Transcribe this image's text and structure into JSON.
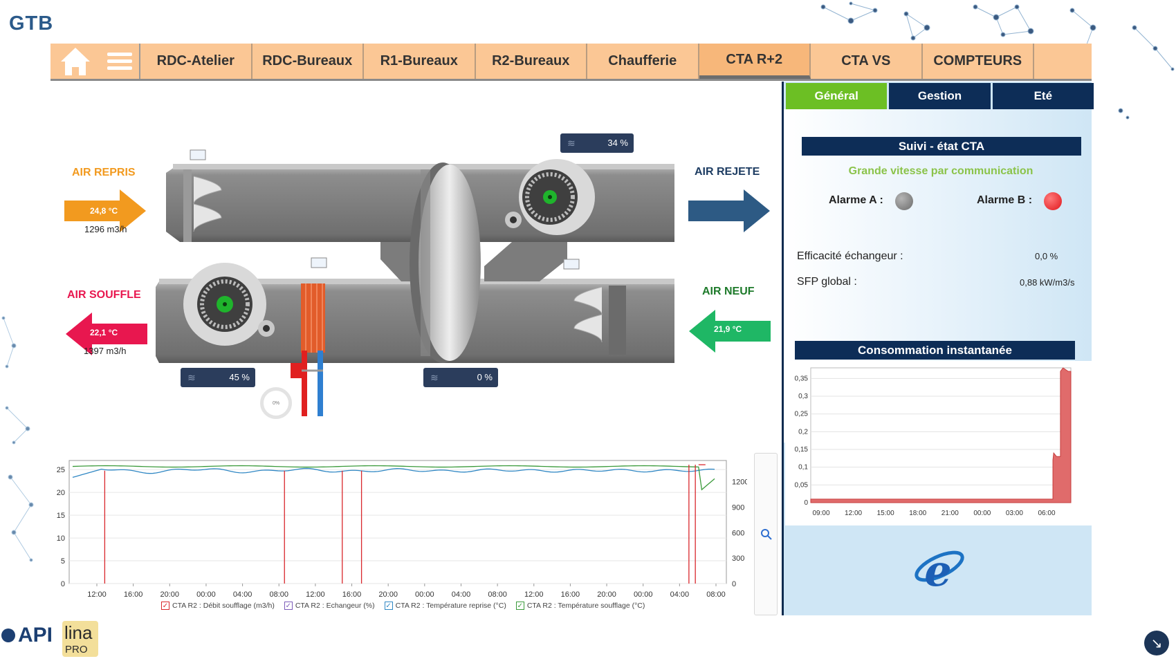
{
  "app": {
    "title": "GTB"
  },
  "nav": {
    "tabs": [
      "RDC-Atelier",
      "RDC-Bureaux",
      "R1-Bureaux",
      "R2-Bureaux",
      "Chaufferie",
      "CTA R+2",
      "CTA VS",
      "COMPTEURS"
    ],
    "active_tab": "CTA R+2",
    "home_icon": "home-icon",
    "menu_icon": "hamburger-menu-icon"
  },
  "right_panel": {
    "tabs": [
      "Général",
      "Gestion",
      "Eté"
    ],
    "active_tab": "Général",
    "suivi_title": "Suivi - état CTA",
    "status_text": "Grande vitesse par communication",
    "alarm_a_label": "Alarme A :",
    "alarm_b_label": "Alarme B :",
    "alarm_a_color": "#7a7a7a",
    "alarm_b_color": "#e0151b",
    "efficacite_label": "Efficacité échangeur  :",
    "efficacite_value": "0,0 %",
    "sfp_label": "SFP global  :",
    "sfp_value": "0,88 kW/m3/s",
    "conso_title": "Consommation instantanée",
    "browser_icon": "internet-explorer-icon"
  },
  "synoptic": {
    "air_repris": {
      "label": "AIR REPRIS",
      "temp": "24,8 °C",
      "flow": "1296 m3/h",
      "color": "#f29a1f"
    },
    "air_rejete": {
      "label": "AIR REJETE",
      "color": "#2d5a84"
    },
    "air_souffle": {
      "label": "AIR SOUFFLE",
      "temp": "22,1 °C",
      "flow": "1397 m3/h",
      "color": "#e8174f"
    },
    "air_neuf": {
      "label": "AIR NEUF",
      "temp": "21,9 °C",
      "color": "#1fb765"
    },
    "wheel_pct": "34 %",
    "supply_fan_pct": "45 %",
    "heating_pct": "0 %",
    "valve_gauge": "0%"
  },
  "conso_chart_data": {
    "type": "area",
    "x_ticks": [
      "09:00",
      "12:00",
      "15:00",
      "18:00",
      "21:00",
      "00:00",
      "03:00",
      "06:00"
    ],
    "y_ticks": [
      "0",
      "0,05",
      "0,1",
      "0,15",
      "0,2",
      "0,25",
      "0,3",
      "0,35"
    ],
    "ylim": [
      0,
      0.38
    ],
    "series": [
      {
        "color": "#e06b6b",
        "points": [
          [
            0,
            0.01
          ],
          [
            0.931,
            0.01
          ],
          [
            0.931,
            0.12
          ],
          [
            0.934,
            0.14
          ],
          [
            0.945,
            0.13
          ],
          [
            0.96,
            0.13
          ],
          [
            0.96,
            0.37
          ],
          [
            0.97,
            0.38
          ],
          [
            0.99,
            0.37
          ],
          [
            1.0,
            0.37
          ]
        ]
      }
    ]
  },
  "trend_chart_data": {
    "type": "line",
    "x_ticks": [
      "12:00",
      "16:00",
      "20:00",
      "00:00",
      "04:00",
      "08:00",
      "12:00",
      "16:00",
      "20:00",
      "00:00",
      "04:00",
      "08:00",
      "12:00",
      "16:00",
      "20:00",
      "00:00",
      "04:00",
      "08:00"
    ],
    "y_left_ticks": [
      "0",
      "5",
      "10",
      "15",
      "20",
      "25"
    ],
    "y_right_ticks": [
      "0",
      "300",
      "600",
      "900",
      "1200"
    ],
    "ylim_left": [
      0,
      27
    ],
    "ylim_right": [
      0,
      1450
    ],
    "series": [
      {
        "name": "CTA R2 : Débit soufflage (m3/h)",
        "color": "#d9262b"
      },
      {
        "name": "CTA R2 : Echangeur (%)",
        "color": "#7b5bb8"
      },
      {
        "name": "CTA R2 : Température reprise (°C)",
        "color": "#2f87c4"
      },
      {
        "name": "CTA R2 : Température soufflage (°C)",
        "color": "#3a9a3a"
      }
    ]
  },
  "footer": {
    "logo_api": "API",
    "logo_lina": "lina",
    "logo_pro": "PRO",
    "corner_icon": "arrow-down-right-icon"
  }
}
